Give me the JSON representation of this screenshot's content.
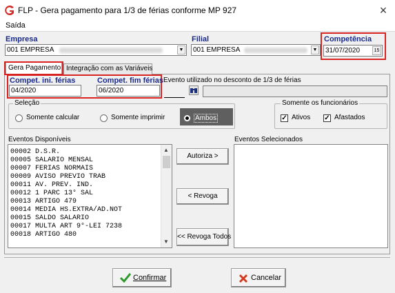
{
  "window": {
    "title": "FLP - Gera pagamento para 1/3 de férias conforme MP 927",
    "close": "×",
    "menu_exit": "Saída"
  },
  "header": {
    "empresa_label": "Empresa",
    "empresa_value": "001 EMPRESA",
    "filial_label": "Filial",
    "filial_value": "001 EMPRESA",
    "competencia_label": "Competência",
    "competencia_value": "31/07/2020",
    "calendar_glyph": "15"
  },
  "tabs": [
    {
      "label": "Gera Pagamento",
      "active": true
    },
    {
      "label": "Integração com as Variáveis",
      "active": false
    }
  ],
  "fields": {
    "compet_ini_label": "Compet. ini. férias",
    "compet_ini_value": "04/2020",
    "compet_fim_label": "Compet. fim férias",
    "compet_fim_value": "06/2020",
    "evento_label": "Evento utilizado no desconto de 1/3 de férias"
  },
  "selecao": {
    "title": "Seleção",
    "options": [
      {
        "label": "Somente calcular",
        "selected": false
      },
      {
        "label": "Somente imprimir",
        "selected": false
      },
      {
        "label": "Ambos",
        "selected": true
      }
    ]
  },
  "funcionarios": {
    "title": "Somente os funcionários",
    "options": [
      {
        "label": "Ativos",
        "checked": true
      },
      {
        "label": "Afastados",
        "checked": true
      }
    ]
  },
  "lists": {
    "disponiveis_label": "Eventos Disponíveis",
    "selecionados_label": "Eventos Selecionados",
    "disponiveis": [
      "00002 D.S.R.",
      "00005 SALARIO MENSAL",
      "00007 FERIAS NORMAIS",
      "00009 AVISO PREVIO TRAB",
      "00011 AV. PREV. IND.",
      "00012 1 PARC 13° SAL",
      "00013 ARTIGO 479",
      "00014 MEDIA HS.EXTRA/AD.NOT",
      "00015 SALDO SALARIO",
      "00017 MULTA ART 9°-LEI 7238",
      "00018 ARTIGO 480"
    ],
    "selecionados": []
  },
  "buttons": {
    "autoriza": "Autoriza >",
    "revoga": "< Revoga",
    "revoga_todos": "<< Revoga Todos",
    "confirmar": "Confirmar",
    "cancelar": "Cancelar"
  },
  "colors": {
    "highlight": "#d92222",
    "label_blue": "#1a2a8c",
    "confirm_icon": "#2e9a2e",
    "cancel_icon": "#d23a1e",
    "ambos_bg": "#5f5f5f"
  }
}
